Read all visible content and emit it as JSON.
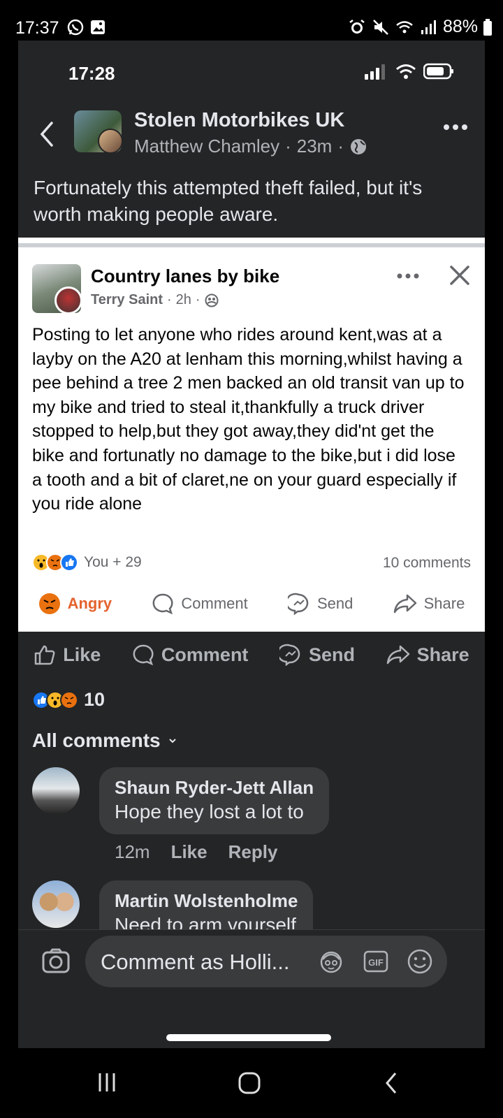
{
  "outer_status": {
    "time": "17:37",
    "battery": "88%"
  },
  "inner_status": {
    "time": "17:28"
  },
  "post": {
    "group_name": "Stolen Motorbikes UK",
    "author": "Matthew Chamley",
    "time": "23m",
    "separator": "·",
    "text": "Fortunately this attempted theft failed, but it's worth making people aware."
  },
  "shared": {
    "group_name": "Country lanes by bike",
    "author": "Terry Saint",
    "time": "2h",
    "separator": "·",
    "text": "Posting to let anyone who rides around kent,was at a layby on the A20 at lenham this morning,whilst having a pee behind a tree 2 men backed an old transit van up to my bike and tried to steal it,thankfully a truck driver stopped to help,but they got away,they did'nt get the bike and fortunatly no damage to the bike,but i did lose a tooth and a bit of claret,ne on your guard especially if you ride alone",
    "reaction_summary": "You + 29",
    "comments_count": "10 comments",
    "actions": {
      "angry": "Angry",
      "comment": "Comment",
      "send": "Send",
      "share": "Share"
    }
  },
  "actions": {
    "like": "Like",
    "comment": "Comment",
    "send": "Send",
    "share": "Share"
  },
  "reaction_count": "10",
  "comments_filter": "All comments",
  "comments": [
    {
      "name": "Shaun Ryder-Jett Allan",
      "text": "Hope they lost a lot to",
      "time": "12m",
      "like": "Like",
      "reply": "Reply"
    },
    {
      "name": "Martin Wolstenholme",
      "text": "Need to arm yourself"
    }
  ],
  "composer": {
    "placeholder": "Comment as Holli...",
    "gif": "GIF"
  },
  "colors": {
    "angry": "#e4632e",
    "like_blue": "#1877f2",
    "dark_bg": "#242526",
    "bubble": "#3a3b3c"
  },
  "icons": [
    "whatsapp-icon",
    "gallery-icon",
    "alarm-icon",
    "mute-icon",
    "wifi-icon",
    "signal-icon",
    "battery-icon",
    "back-icon",
    "more-icon",
    "globe-icon",
    "close-icon",
    "friends-icon",
    "like-icon",
    "comment-icon",
    "messenger-icon",
    "share-icon",
    "camera-icon",
    "avatar-sticker-icon",
    "gif-icon",
    "emoji-icon",
    "recents-icon",
    "home-icon",
    "back-nav-icon"
  ]
}
